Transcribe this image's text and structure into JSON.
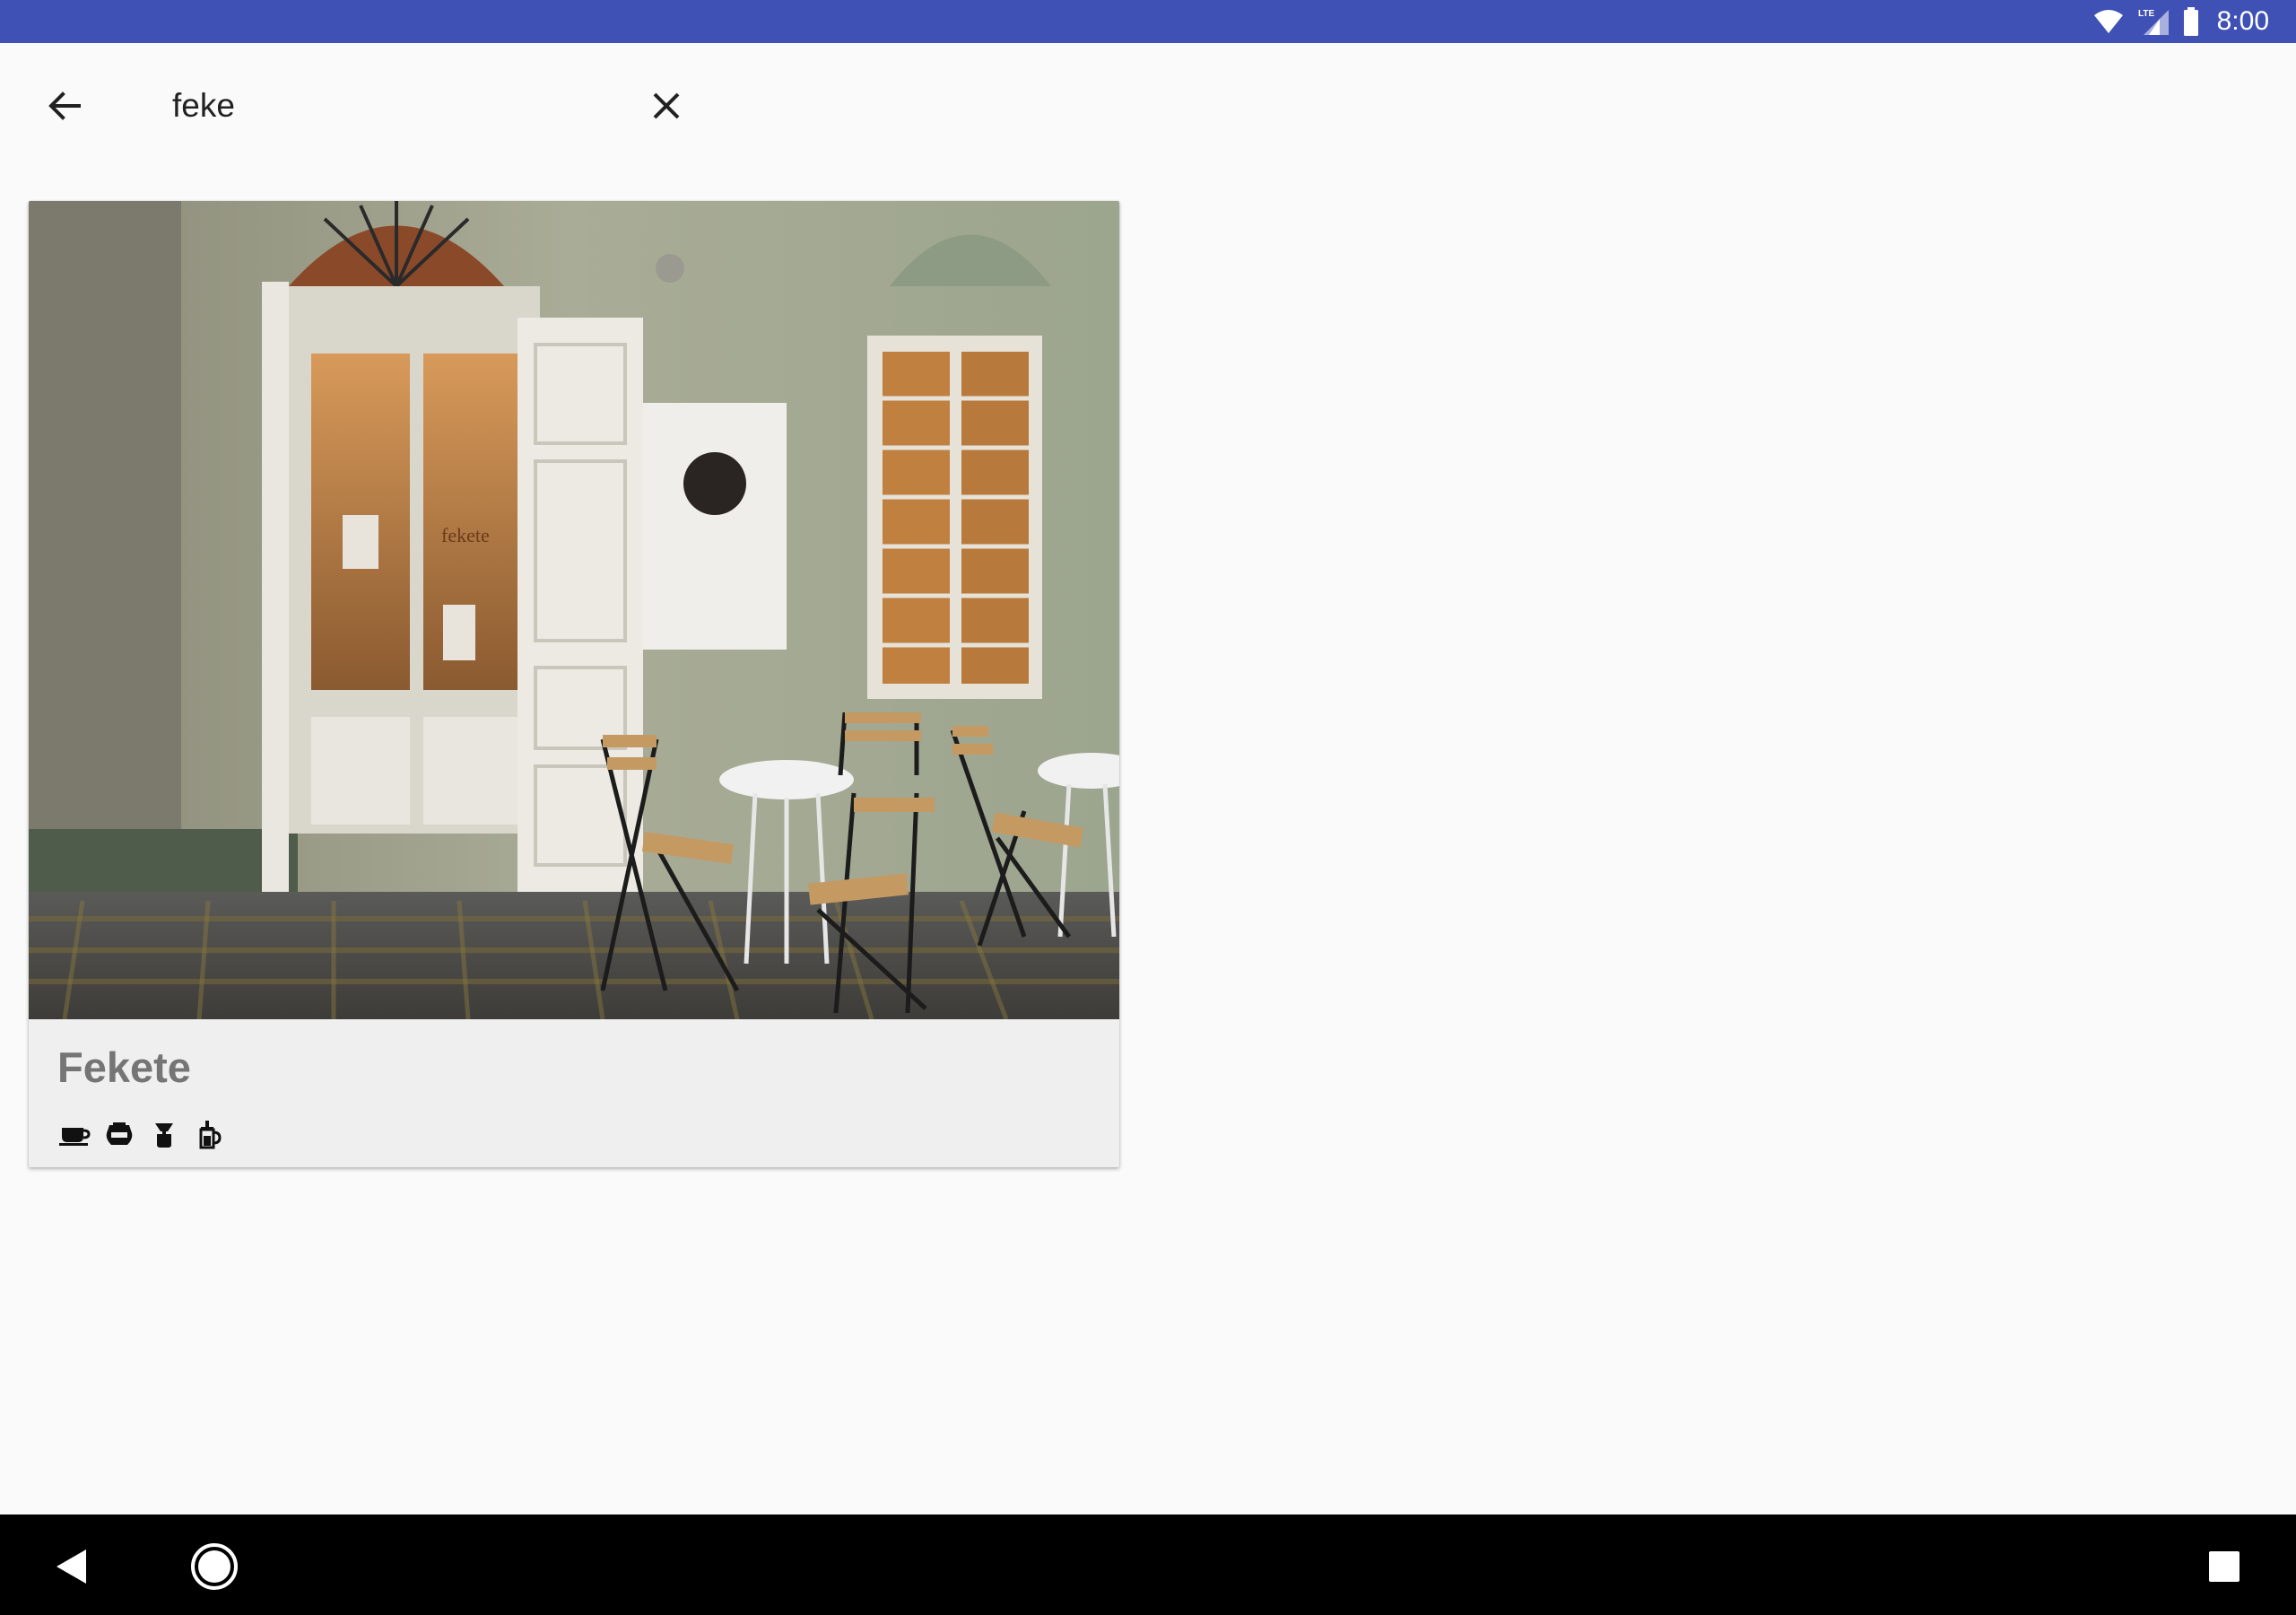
{
  "status_bar": {
    "time": "8:00",
    "network_label": "LTE",
    "icons": [
      "wifi-icon",
      "cellular-lte-icon",
      "battery-icon"
    ],
    "background_color": "#3f51b5"
  },
  "search": {
    "query": "feke",
    "back_icon": "arrow-left-icon",
    "clear_icon": "close-icon"
  },
  "results": [
    {
      "title": "Fekete",
      "photo_sign_text": "fekete",
      "brew_icons": [
        "espresso-cup-icon",
        "coffee-pot-icon",
        "pour-over-icon",
        "french-press-icon"
      ]
    }
  ],
  "nav_bar": {
    "buttons": [
      "back-triangle-icon",
      "home-circle-icon",
      "recents-square-icon"
    ]
  }
}
